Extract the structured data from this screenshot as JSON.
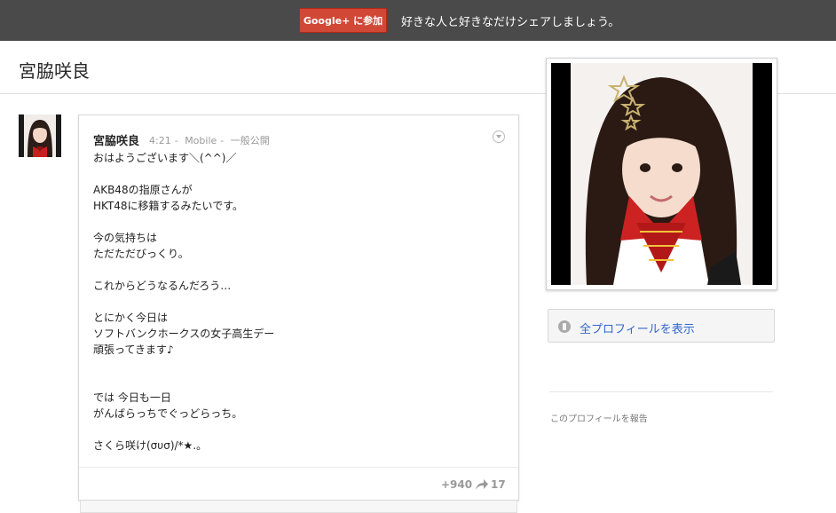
{
  "topbar": {
    "join_label": "Google+ に参加",
    "tagline": "好きな人と好きなだけシェアしましょう。"
  },
  "header": {
    "title": "宮脇咲良"
  },
  "post": {
    "author": "宮脇咲良",
    "time": "4:21",
    "source": "Mobile",
    "visibility": "一般公開",
    "lines": [
      "おはようございます＼(^^)／",
      "",
      "AKB48の指原さんが",
      "HKT48に移籍するみたいです。",
      "",
      "今の気持ちは",
      "ただただびっくり。",
      "",
      "これからどうなるんだろう…",
      "",
      "とにかく今日は",
      "ソフトバンクホークスの女子高生デー",
      "頑張ってきます♪",
      "",
      "",
      "では 今日も一日",
      "がんばらっちでぐっどらっち。",
      "",
      "さくら咲け(συσ)/*★.。"
    ],
    "plus_count": "+940",
    "share_count": "17"
  },
  "sidebar": {
    "profile_button_label": "全プロフィールを表示",
    "report_label": "このプロフィールを報告"
  },
  "colors": {
    "topbar_bg": "#4a4a4a",
    "join_red": "#d14836",
    "link_blue": "#3366cc"
  }
}
